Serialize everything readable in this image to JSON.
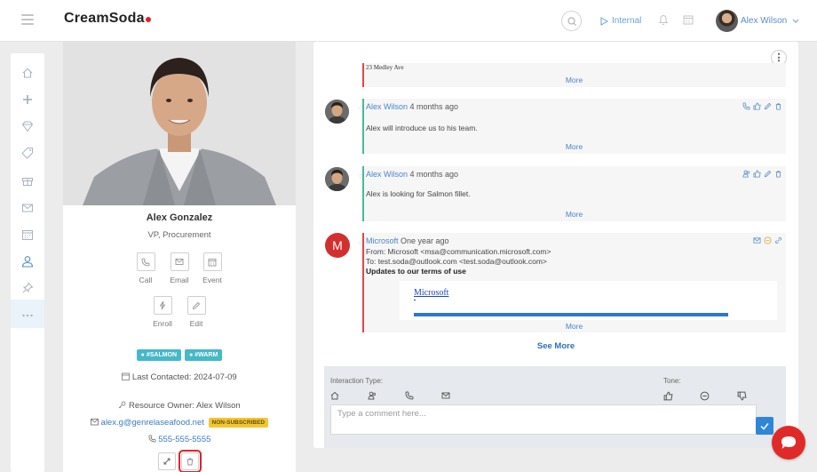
{
  "app": {
    "logo": "CreamSoda",
    "brand_color": "#e0202b"
  },
  "header": {
    "visibility_label": "Internal",
    "user_name": "Alex Wilson"
  },
  "nav": {
    "icons": [
      "home-icon",
      "plus-icon",
      "diamond-icon",
      "tag-icon",
      "gift-icon",
      "mail-icon",
      "calendar-icon",
      "user-icon",
      "pin-icon",
      "more-icon"
    ],
    "active": "user-icon"
  },
  "profile": {
    "name": "Alex Gonzalez",
    "title": "VP, Procurement",
    "actions": [
      {
        "label": "Call"
      },
      {
        "label": "Email"
      },
      {
        "label": "Event"
      },
      {
        "label": "Enroll"
      },
      {
        "label": "Edit"
      }
    ],
    "tags": [
      "#SALMON",
      "#WARM"
    ],
    "last_contacted": "Last Contacted: 2024-07-09",
    "resource_owner": "Resource Owner: Alex Wilson",
    "email": "alex.g@genrelaseafood.net",
    "email_status": "NON-SUBSCRIBED",
    "phone": "555-555-5555"
  },
  "feed": {
    "first_card": {
      "address": "23 Medley Ave",
      "more": "More"
    },
    "items": [
      {
        "author": "Alex Wilson",
        "time": "4 months ago",
        "body": "Alex will introduce us to his team.",
        "more": "More",
        "accent": "#4bb89a"
      },
      {
        "author": "Alex Wilson",
        "time": "4 months ago",
        "body": "Alex is looking for Salmon fillet.",
        "more": "More",
        "accent": "#4bb89a"
      }
    ],
    "email_item": {
      "avatar_letter": "M",
      "author": "Microsoft",
      "time": "One year ago",
      "from": "From: Microsoft <msa@communication.microsoft.com>",
      "to": "To: test.soda@outlook.com <test.soda@outlook.com>",
      "subject": "Updates to our terms of use",
      "image_link": "Microsoft",
      "more": "More",
      "accent": "#e04848"
    },
    "see_more": "See More"
  },
  "compose": {
    "interaction_type_label": "Interaction Type:",
    "tone_label": "Tone:",
    "placeholder": "Type a comment here..."
  }
}
